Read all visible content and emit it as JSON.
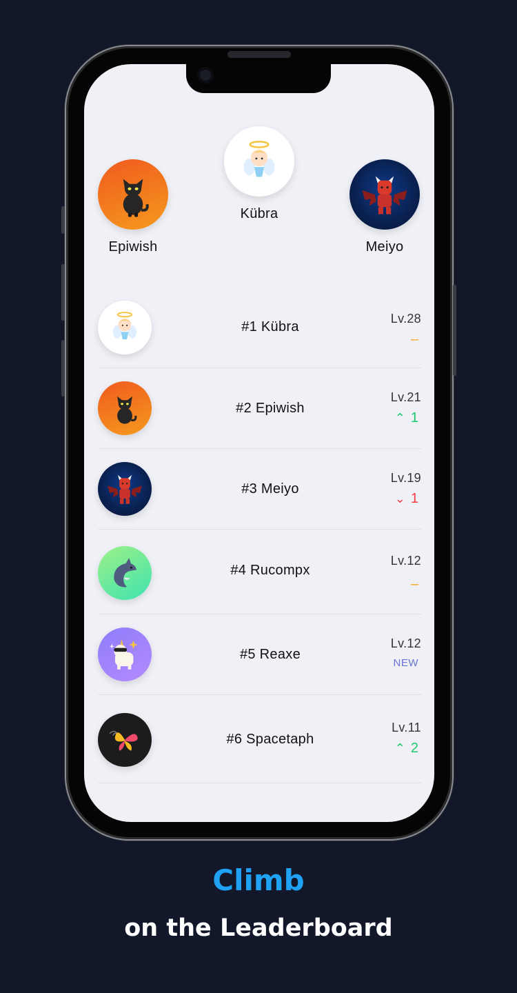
{
  "podium": {
    "first": {
      "name": "Kübra",
      "avatar": "angel-avatar"
    },
    "second": {
      "name": "Epiwish",
      "avatar": "black-cat-avatar"
    },
    "third": {
      "name": "Meiyo",
      "avatar": "red-devil-avatar"
    }
  },
  "leaderboard": [
    {
      "label": "#1 Kübra",
      "level": "Lv.28",
      "change": "–",
      "change_type": "same",
      "avatar": "angel-avatar"
    },
    {
      "label": "#2 Epiwish",
      "level": "Lv.21",
      "change": "1",
      "change_type": "up",
      "avatar": "black-cat-avatar"
    },
    {
      "label": "#3 Meiyo",
      "level": "Lv.19",
      "change": "1",
      "change_type": "down",
      "avatar": "red-devil-avatar"
    },
    {
      "label": "#4 Rucompx",
      "level": "Lv.12",
      "change": "–",
      "change_type": "same",
      "avatar": "dolphin-avatar"
    },
    {
      "label": "#5 Reaxe",
      "level": "Lv.12",
      "change": "NEW",
      "change_type": "new",
      "avatar": "unicorn-avatar"
    },
    {
      "label": "#6 Spacetaph",
      "level": "Lv.11",
      "change": "2",
      "change_type": "up",
      "avatar": "butterfly-avatar"
    }
  ],
  "caption": {
    "title": "Climb",
    "subtitle": "on the Leaderboard"
  },
  "colors": {
    "background": "#121829",
    "screen": "#eff1f7",
    "accent": "#1fa2f4",
    "up": "#20c76b",
    "down": "#ef3f45",
    "same": "#f5a623",
    "new": "#6872d8"
  }
}
